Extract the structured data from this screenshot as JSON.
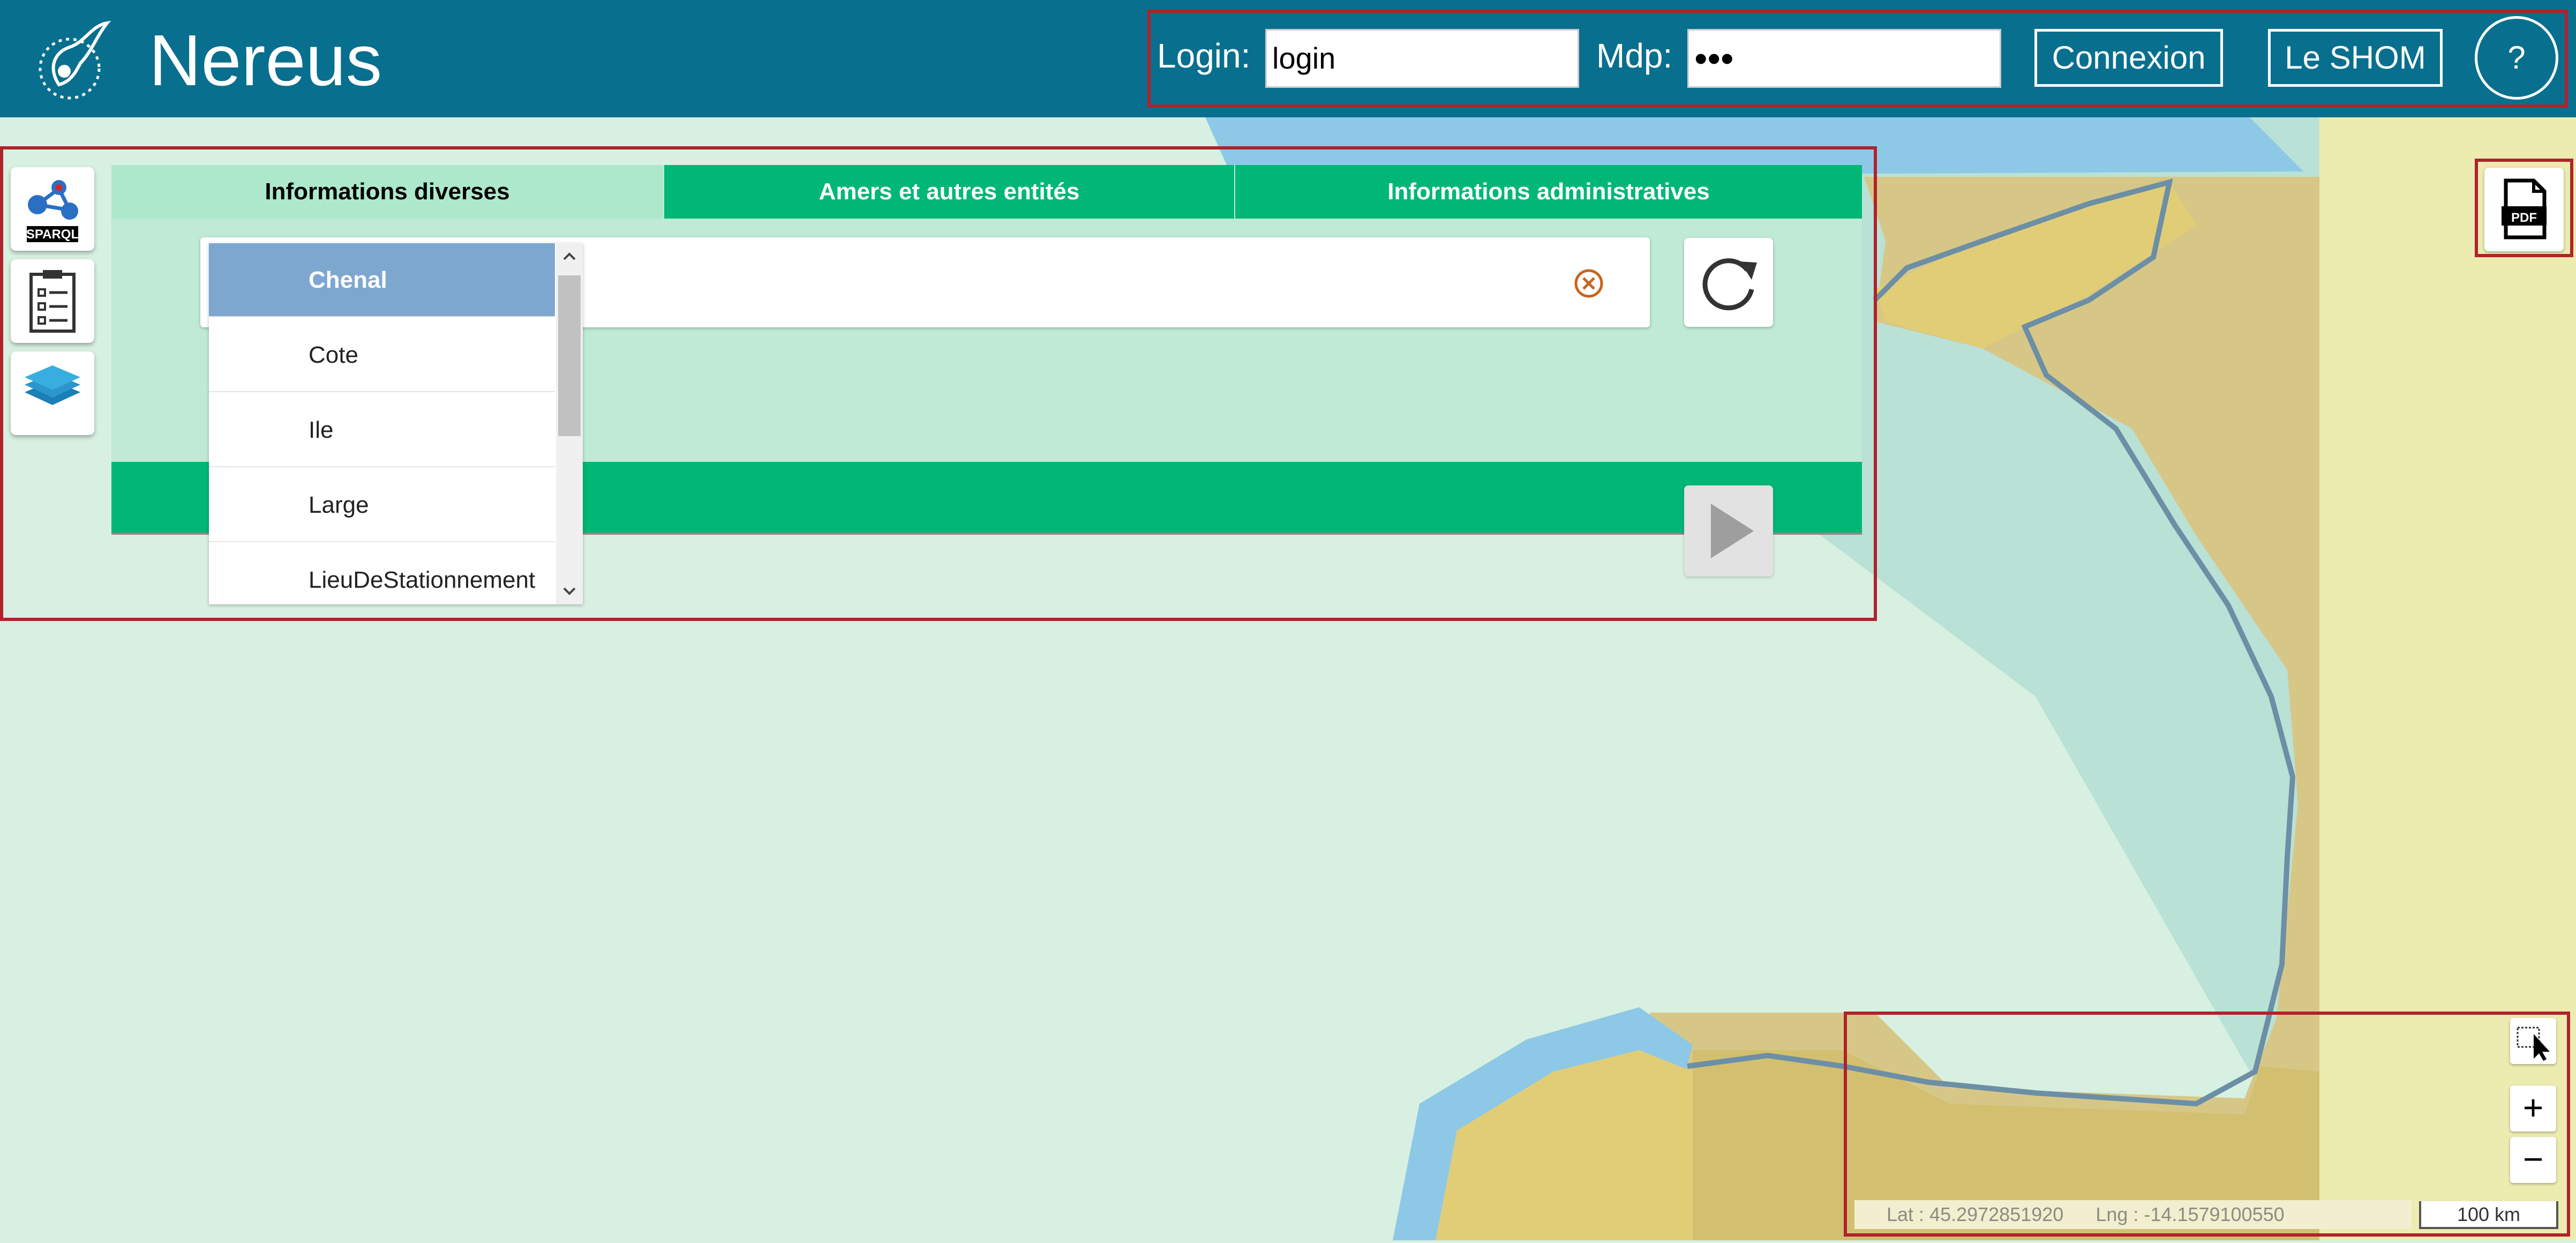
{
  "app": {
    "title": "Nereus"
  },
  "login": {
    "login_label": "Login:",
    "login_value": "login",
    "mdp_label": "Mdp:",
    "mdp_value": "•••",
    "connect_label": "Connexion",
    "shom_label": "Le SHOM",
    "help_label": "?"
  },
  "tabs": [
    {
      "label": "Informations diverses",
      "active": true
    },
    {
      "label": "Amers et autres entités",
      "active": false
    },
    {
      "label": "Informations administratives",
      "active": false
    }
  ],
  "dropdown": {
    "items": [
      "Chenal",
      "Cote",
      "Ile",
      "Large",
      "LieuDeStationnement"
    ],
    "selected": "Chenal"
  },
  "left_tools": [
    {
      "name": "sparql-button",
      "icon": "sparql-icon",
      "label": "SPARQL"
    },
    {
      "name": "list-button",
      "icon": "clipboard-list-icon"
    },
    {
      "name": "layers-button",
      "icon": "layers-icon"
    }
  ],
  "pdf_label": "PDF",
  "map": {
    "lat_text": "Lat : 45.2972851920",
    "lng_text": "Lng : -14.1579100550",
    "scale_label": "100 km",
    "zoom_in": "+",
    "zoom_out": "−"
  },
  "colors": {
    "header": "#086f8e",
    "tab_active": "#aee8cc",
    "tab_inactive": "#00b775",
    "highlight": "#b0222c",
    "sea_deep": "#8dc9e6",
    "land": "#e3cc72"
  }
}
